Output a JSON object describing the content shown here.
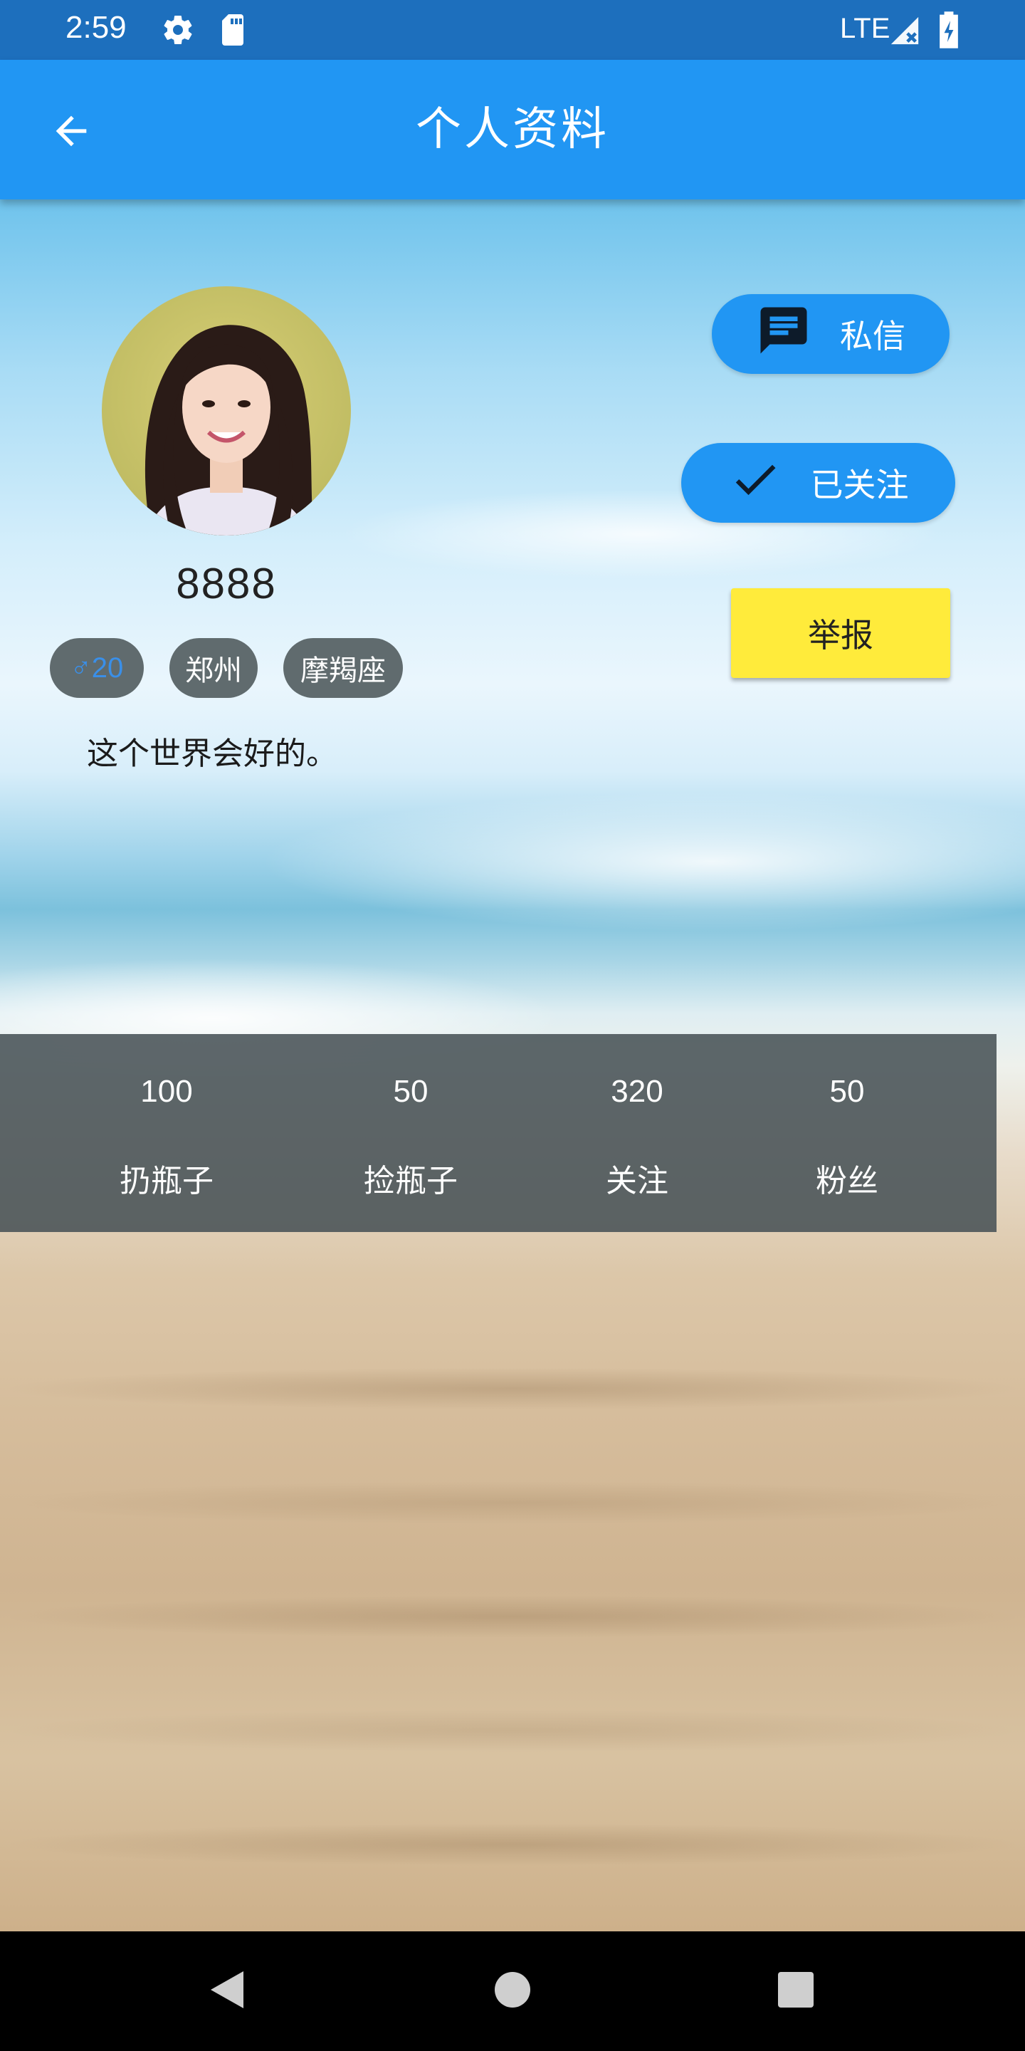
{
  "status_bar": {
    "time": "2:59",
    "network": "LTE",
    "icons": [
      "gear-icon",
      "sd-card-icon",
      "signal-icon",
      "battery-charging-icon"
    ]
  },
  "app_bar": {
    "title": "个人资料",
    "back_icon": "arrow-back-icon"
  },
  "profile": {
    "nickname": "8888",
    "tags": {
      "gender_age": "♂20",
      "city": "郑州",
      "zodiac": "摩羯座"
    },
    "signature": "这个世界会好的。"
  },
  "actions": {
    "message_label": "私信",
    "follow_label": "已关注",
    "report_label": "举报"
  },
  "stats": [
    {
      "value": "100",
      "label": "扔瓶子"
    },
    {
      "value": "50",
      "label": "捡瓶子"
    },
    {
      "value": "320",
      "label": "关注"
    },
    {
      "value": "50",
      "label": "粉丝"
    }
  ],
  "colors": {
    "status_bar": "#1d6fbd",
    "app_bar": "#2196f3",
    "pill_button": "#2196f3",
    "report_button": "#ffeb3b",
    "stats_bar": "#485256",
    "tag": "#606b6e",
    "gender_text": "#3a8fe8"
  }
}
